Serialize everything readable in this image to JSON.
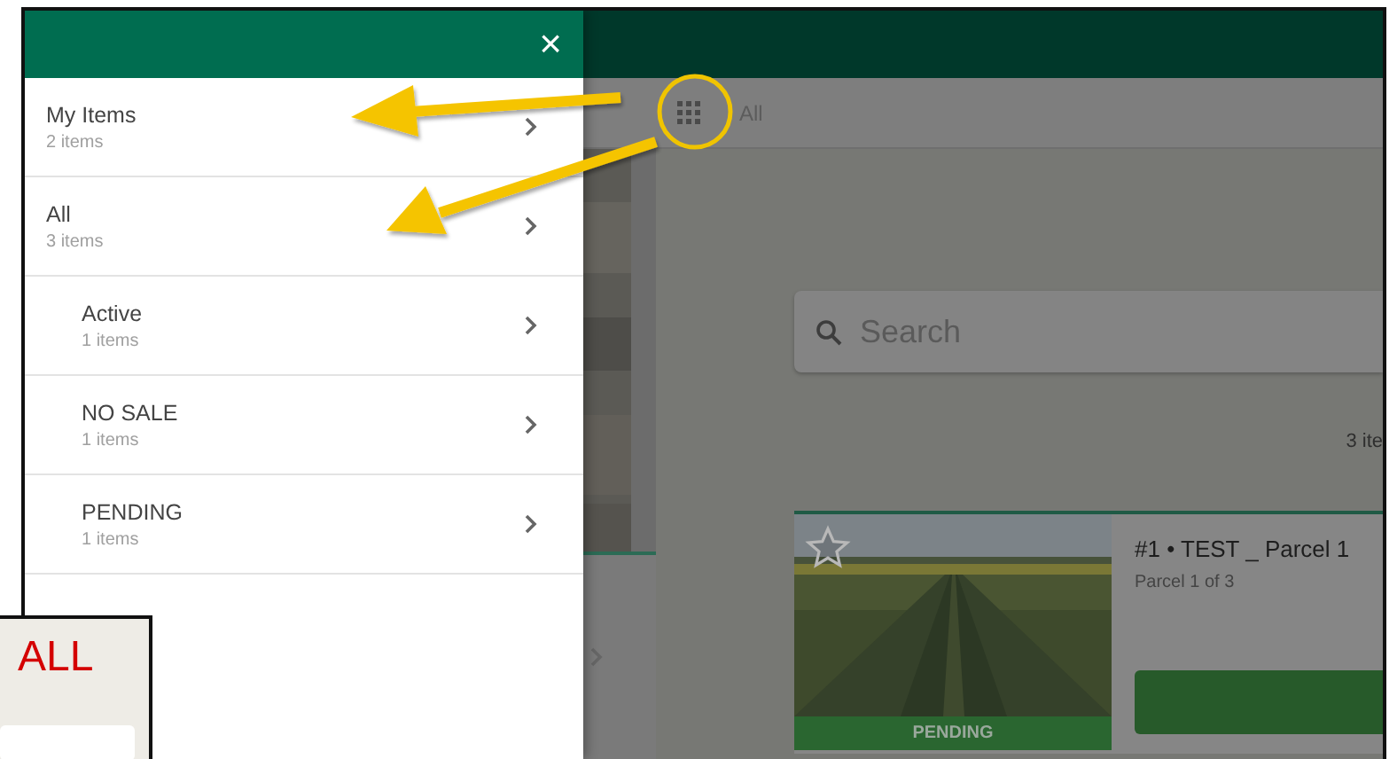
{
  "drawer": {
    "close": "×",
    "items": [
      {
        "label": "My Items",
        "count": "2 items"
      },
      {
        "label": "All",
        "count": "3 items",
        "children": [
          {
            "label": "Active",
            "count": "1 items"
          },
          {
            "label": "NO SALE",
            "count": "1 items"
          },
          {
            "label": "PENDING",
            "count": "1 items"
          }
        ]
      }
    ]
  },
  "toolbar": {
    "crumb": "All"
  },
  "search": {
    "placeholder": "Search"
  },
  "results_count": "3 ite",
  "card": {
    "title": "#1 • TEST _ Parcel 1",
    "subtitle": "Parcel 1 of 3",
    "status": "PENDING",
    "favorite": false
  },
  "callout": {
    "text": "ALL"
  }
}
